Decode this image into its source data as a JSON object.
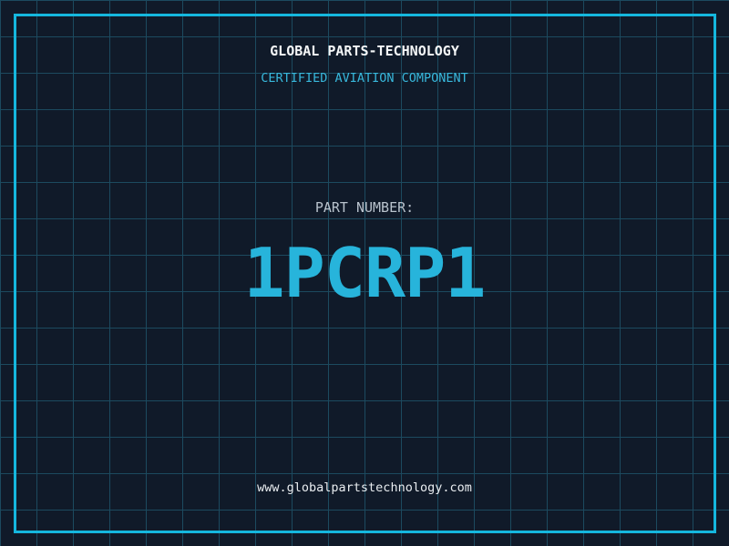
{
  "brand": {
    "title": "GLOBAL PARTS-TECHNOLOGY",
    "tagline": "CERTIFIED AVIATION COMPONENT"
  },
  "part": {
    "label": "PART NUMBER:",
    "number": "1PCRP1"
  },
  "footer": {
    "website": "www.globalpartstechnology.com"
  },
  "colors": {
    "background": "#101a29",
    "grid_line": "#1c4a5f",
    "frame": "#15b7de",
    "accent_cyan": "#27b4db",
    "tagline_cyan": "#38b8dc",
    "label_grey": "#b9c3cd",
    "text_white": "#f4f6f7"
  },
  "layout": {
    "grid_spacing_px": 40
  }
}
